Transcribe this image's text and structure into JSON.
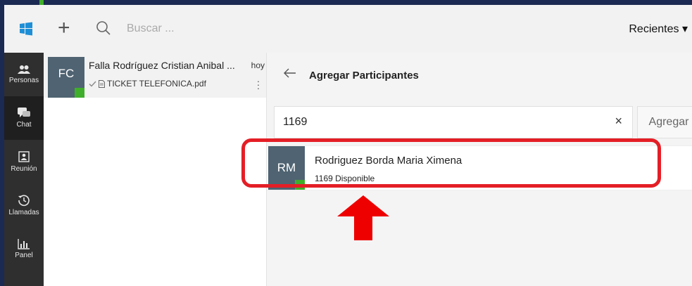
{
  "topbar": {
    "search_placeholder": "Buscar ...",
    "recents_label": "Recientes ▾"
  },
  "sidebar": {
    "items": [
      {
        "label": "Personas",
        "icon": "people-icon"
      },
      {
        "label": "Chat",
        "icon": "chat-icon"
      },
      {
        "label": "Reunión",
        "icon": "meeting-icon"
      },
      {
        "label": "Llamadas",
        "icon": "history-icon"
      },
      {
        "label": "Panel",
        "icon": "chart-icon"
      }
    ]
  },
  "conversation": {
    "initials": "FC",
    "name": "Falla Rodríguez Cristian Anibal ...",
    "time": "hoy",
    "attachment": "TICKET TELEFONICA.pdf"
  },
  "main": {
    "title": "Agregar Participantes",
    "search_value": "1169",
    "clear_label": "×",
    "add_label": "Agregar",
    "result": {
      "initials": "RM",
      "name": "Rodriguez Borda Maria Ximena",
      "detail": "1169  Disponible"
    }
  },
  "colors": {
    "accent_green": "#3fae2a",
    "avatar_bg": "#4f6372",
    "highlight_red": "#e41e26",
    "frame_navy": "#1b2a52"
  }
}
